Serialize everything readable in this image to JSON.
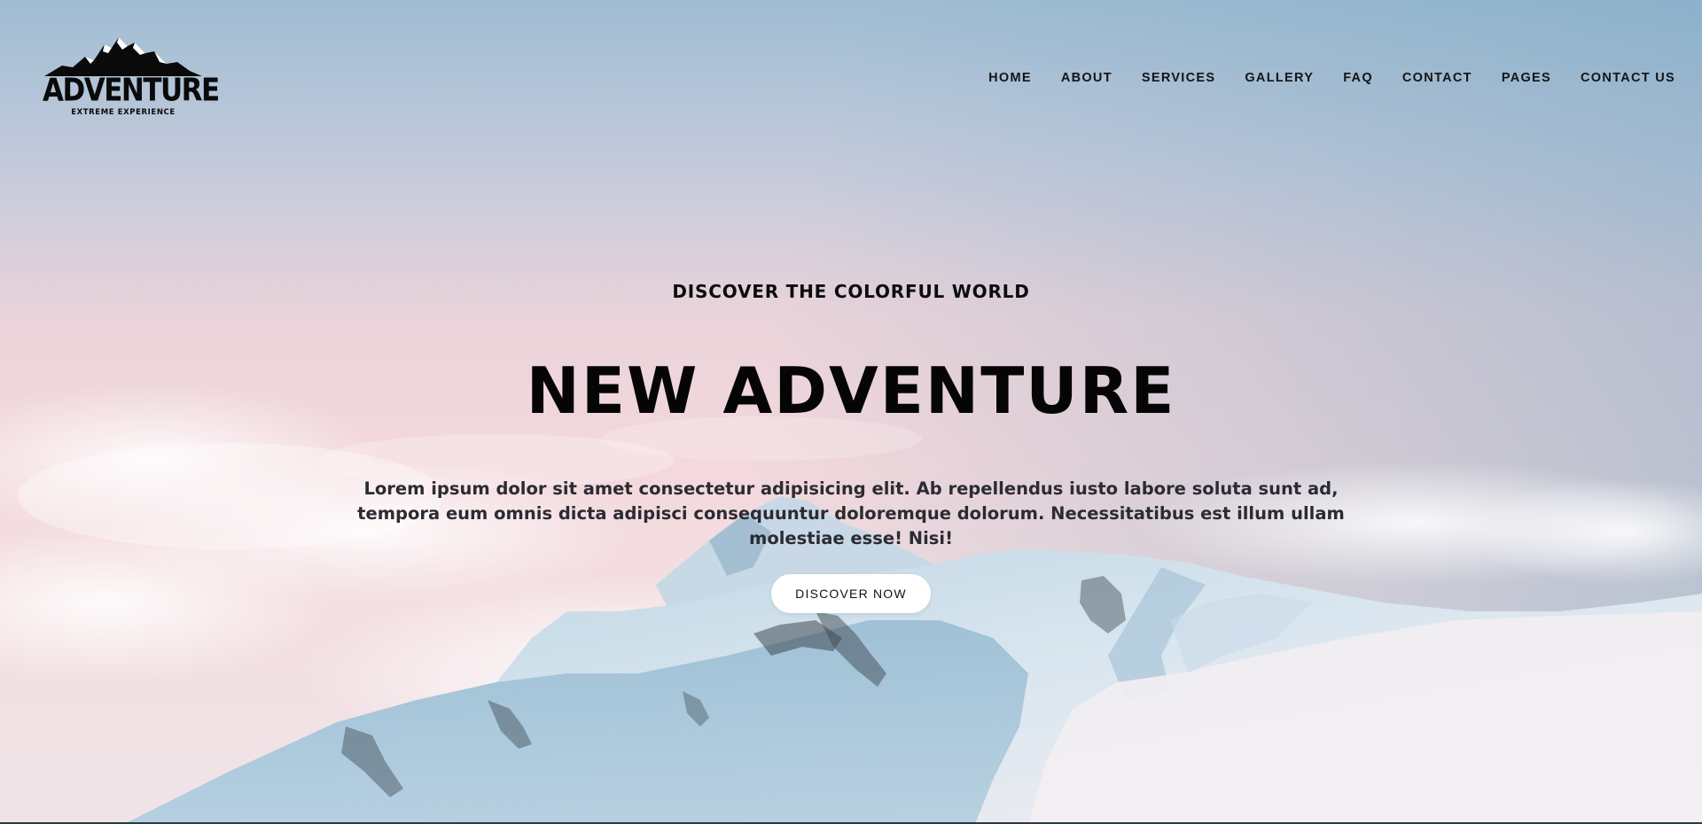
{
  "brand": {
    "name": "ADVENTURE",
    "tagline": "EXTREME EXPERIENCE",
    "logo_icon": "mountain-peaks-icon"
  },
  "nav": {
    "items": [
      {
        "label": "HOME"
      },
      {
        "label": "ABOUT"
      },
      {
        "label": "SERVICES"
      },
      {
        "label": "GALLERY"
      },
      {
        "label": "FAQ"
      },
      {
        "label": "CONTACT"
      },
      {
        "label": "PAGES"
      },
      {
        "label": "CONTACT US"
      }
    ]
  },
  "hero": {
    "kicker": "DISCOVER THE COLORFUL WORLD",
    "headline": "NEW ADVENTURE",
    "lead": "Lorem ipsum dolor sit amet consectetur adipisicing elit. Ab repellendus iusto labore soluta sunt ad, tempora eum omnis dicta adipisci consequuntur doloremque dolorum. Necessitatibus est illum ullam molestiae esse! Nisi!",
    "cta_label": "DISCOVER NOW",
    "background": "snowy-mountain-above-clouds"
  },
  "colors": {
    "text_dark": "#0a0a0a",
    "cta_bg": "#ffffff",
    "sky_top": "#9fbdd3",
    "sky_pink": "#f3d8dc",
    "snow_shadow": "#9fc1d6"
  }
}
